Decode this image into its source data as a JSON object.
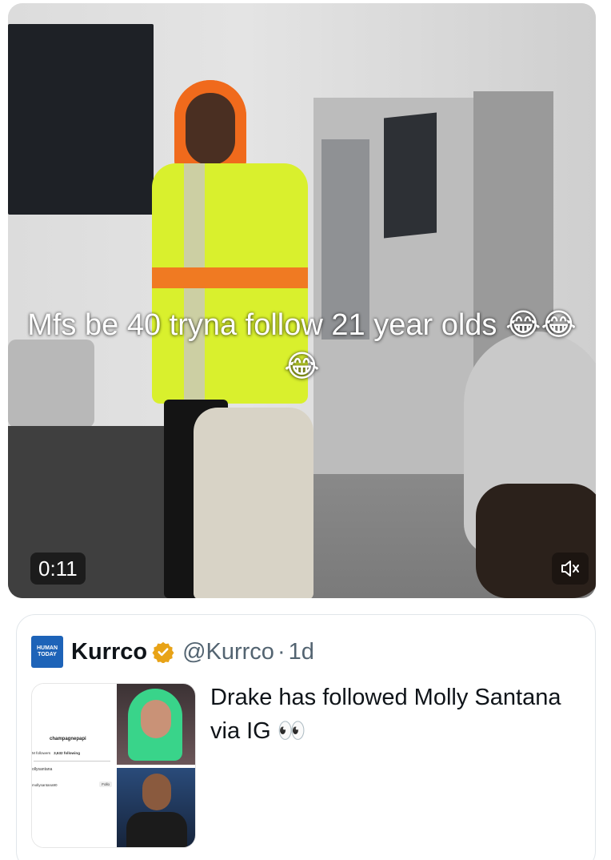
{
  "video": {
    "caption": "Mfs be 40 tryna follow 21 year olds 😂😂😂",
    "timestamp": "0:11",
    "mute_icon": "speaker-muted-icon"
  },
  "quoted_post": {
    "avatar_text": "HUMAN TODAY",
    "author_name": "Kurrco",
    "verified_icon": "gold-verified-badge-icon",
    "handle": "@Kurrco",
    "separator": "·",
    "time": "1d",
    "text": "Drake has followed Molly Santana via IG 👀",
    "media_screenshot": {
      "username": "champagnepapi",
      "followers": "M followers",
      "following": "3,632 following",
      "search": "ollysantana",
      "result": "mollysantana90",
      "follow_label": "Follo"
    }
  },
  "colors": {
    "accent_gold": "#e8a317",
    "handle_gray": "#536471",
    "text": "#0f1419"
  }
}
